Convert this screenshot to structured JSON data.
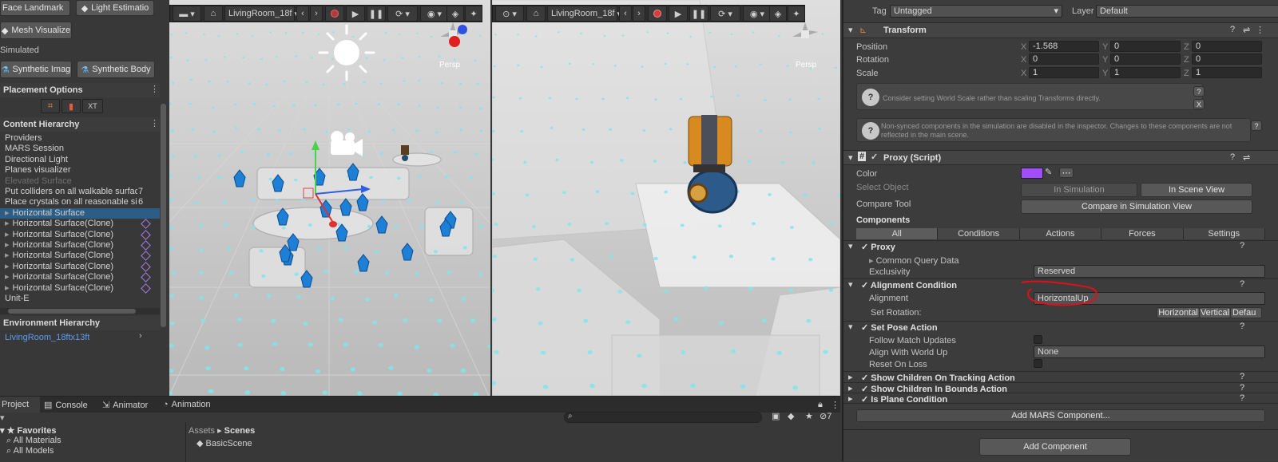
{
  "simulation_buttons": {
    "face_landmark": "Face Landmark",
    "light_estimation": "Light Estimatio",
    "mesh_visualize": "Mesh Visualize",
    "simulated_label": "Simulated",
    "synthetic_image": "Synthetic Imag",
    "synthetic_body": "Synthetic Body"
  },
  "placement": {
    "title": "Placement Options",
    "xt_label": "XT"
  },
  "content_hierarchy": {
    "title": "Content Hierarchy",
    "items": [
      {
        "label": "Providers",
        "extra": ""
      },
      {
        "label": "MARS Session",
        "extra": ""
      },
      {
        "label": "Directional Light",
        "extra": ""
      },
      {
        "label": "Planes visualizer",
        "extra": ""
      },
      {
        "label": "Elevated Surface",
        "extra": ""
      },
      {
        "label": "Put colliders on all walkable surfac",
        "extra": "7"
      },
      {
        "label": "Place crystals on all reasonable siz",
        "extra": "6"
      },
      {
        "label": "Horizontal Surface",
        "extra": ""
      },
      {
        "label": "Horizontal Surface(Clone)",
        "extra": ""
      },
      {
        "label": "Horizontal Surface(Clone)",
        "extra": ""
      },
      {
        "label": "Horizontal Surface(Clone)",
        "extra": ""
      },
      {
        "label": "Horizontal Surface(Clone)",
        "extra": ""
      },
      {
        "label": "Horizontal Surface(Clone)",
        "extra": ""
      },
      {
        "label": "Horizontal Surface(Clone)",
        "extra": ""
      },
      {
        "label": "Horizontal Surface(Clone)",
        "extra": ""
      },
      {
        "label": "Unit-E",
        "extra": ""
      }
    ]
  },
  "environment_hierarchy": {
    "title": "Environment Hierarchy",
    "item": "LivingRoom_18ftx13ft"
  },
  "scene_view": {
    "env_label": "LivingRoom_18f",
    "persp_label": "Persp"
  },
  "sim_view": {
    "env_label": "LivingRoom_18f",
    "persp_label": "Persp"
  },
  "bottom_tabs": {
    "project": "Project",
    "console": "Console",
    "animator": "Animator",
    "animation": "Animation",
    "badge": "7"
  },
  "project": {
    "favorites": "Favorites",
    "all_materials": "All Materials",
    "all_models": "All Models",
    "breadcrumb_root": "Assets",
    "breadcrumb_current": "Scenes",
    "scene_item": "BasicScene"
  },
  "inspector": {
    "tag_label": "Tag",
    "tag_value": "Untagged",
    "layer_label": "Layer",
    "layer_value": "Default",
    "transform_title": "Transform",
    "position_label": "Position",
    "rotation_label": "Rotation",
    "scale_label": "Scale",
    "axis_x": "X",
    "axis_y": "Y",
    "axis_z": "Z",
    "position": [
      "-1.568",
      "0",
      "0"
    ],
    "rotation": [
      "0",
      "0",
      "0"
    ],
    "scale": [
      "1",
      "1",
      "1"
    ],
    "help1": "Consider setting World Scale rather than scaling Transforms directly.",
    "help2": "Non-synced components in the simulation are disabled in the inspector. Changes to these components are not reflected in the main scene.",
    "proxy_script_title": "Proxy (Script)",
    "color_label": "Color",
    "select_object_label": "Select Object",
    "in_simulation": "In Simulation",
    "in_scene_view": "In Scene View",
    "compare_tool_label": "Compare Tool",
    "compare_button": "Compare in Simulation View",
    "components_label": "Components",
    "tabs": [
      "All",
      "Conditions",
      "Actions",
      "Forces",
      "Settings"
    ],
    "proxy_label": "Proxy",
    "common_query": "Common Query Data",
    "exclusivity_label": "Exclusivity",
    "exclusivity_value": "Reserved",
    "alignment_condition": "Alignment Condition",
    "alignment_label": "Alignment",
    "alignment_value": "HorizontalUp",
    "set_rotation_label": "Set Rotation:",
    "rot_horizontal": "Horizontal",
    "rot_vertical": "Vertical",
    "rot_default": "Defau",
    "set_pose": "Set Pose Action",
    "follow_match": "Follow Match Updates",
    "align_world": "Align With World Up",
    "align_world_value": "None",
    "reset_on_loss": "Reset On Loss",
    "show_children_tracking": "Show Children On Tracking Action",
    "show_children_bounds": "Show Children In Bounds Action",
    "is_plane": "Is Plane Condition",
    "add_mars": "Add MARS Component...",
    "add_component": "Add Component"
  },
  "colors": {
    "accent": "#3e6aa8",
    "proxy_color": "#a24bff",
    "annotation": "#e0101a",
    "crystal": "#1e7fd6",
    "dots": "#7fe6ee"
  }
}
